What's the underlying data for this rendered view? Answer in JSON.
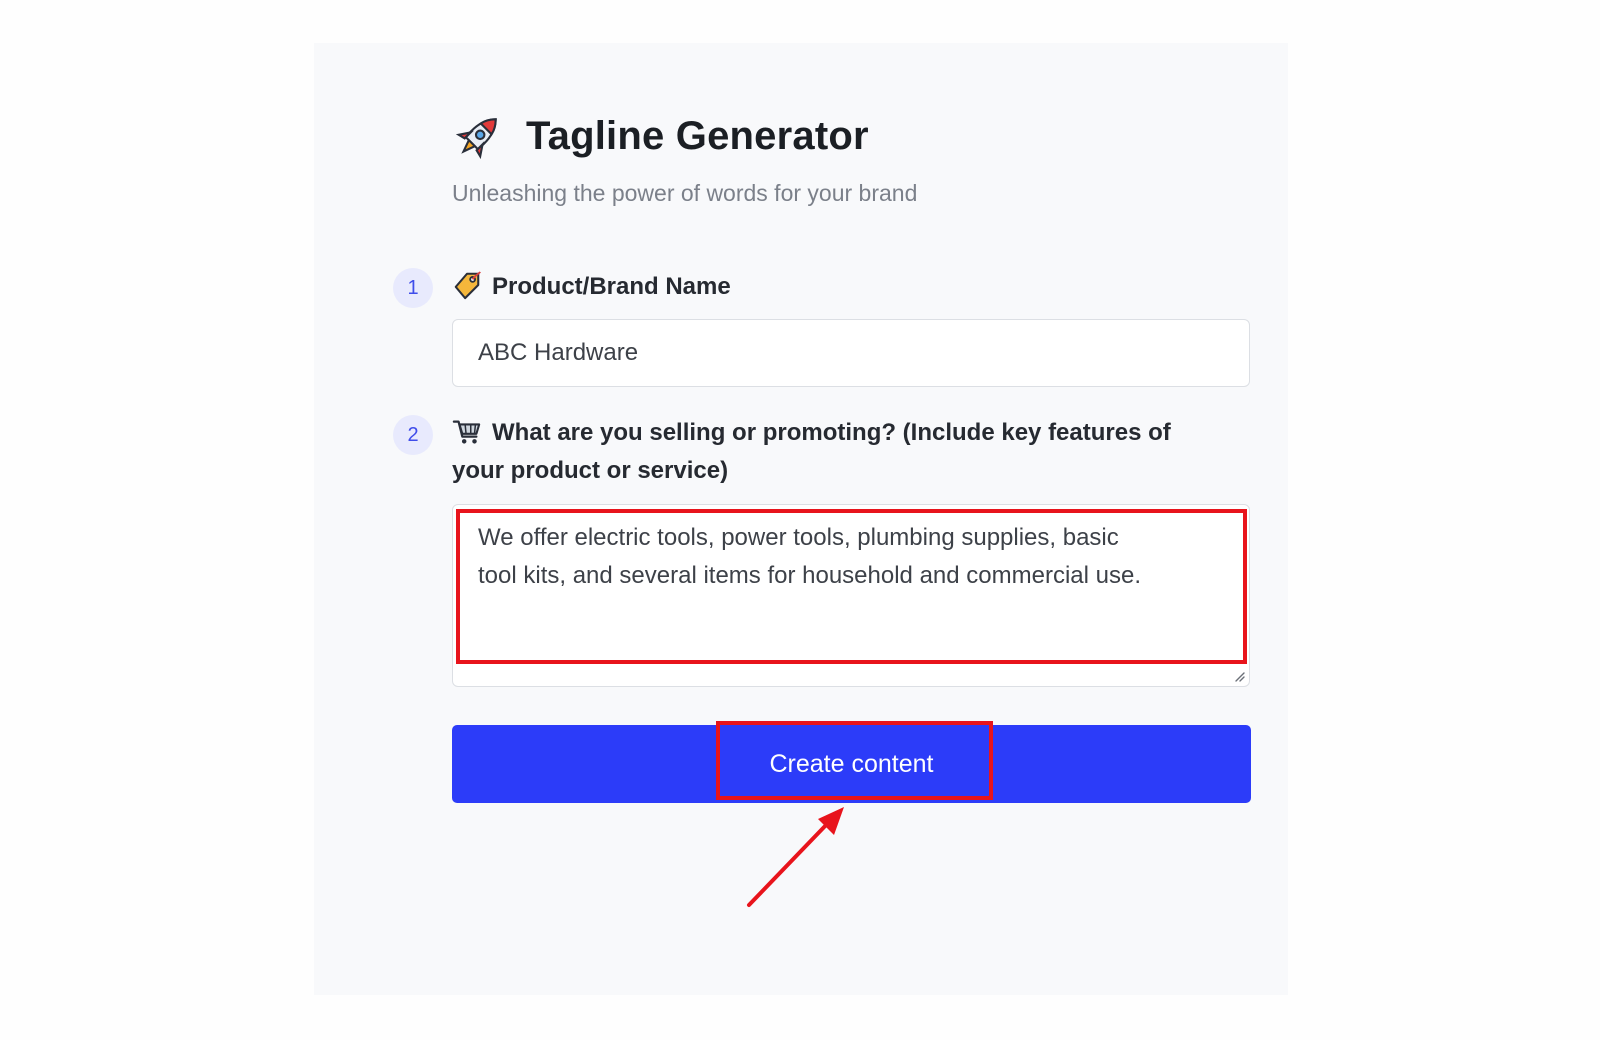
{
  "header": {
    "title": "Tagline Generator",
    "subtitle": "Unleashing the power of words for your brand",
    "title_icon": "rocket-icon"
  },
  "steps": [
    {
      "number": "1",
      "icon": "label-tag-icon",
      "label": "Product/Brand Name",
      "field_value": "ABC Hardware"
    },
    {
      "number": "2",
      "icon": "shopping-cart-icon",
      "label_line1": "What are you selling or promoting? (Include key features of",
      "label_line2": "your product or service)",
      "field_line1": "We offer electric tools, power tools, plumbing supplies, basic",
      "field_line2": "tool kits, and several items for household and commercial use."
    }
  ],
  "actions": {
    "create_label": "Create content"
  },
  "colors": {
    "accent": "#2c3cf9",
    "annotation": "#e8141c",
    "badge_bg": "#e8eafd",
    "badge_text": "#3f4dea",
    "panel_bg": "#f8f9fb"
  }
}
